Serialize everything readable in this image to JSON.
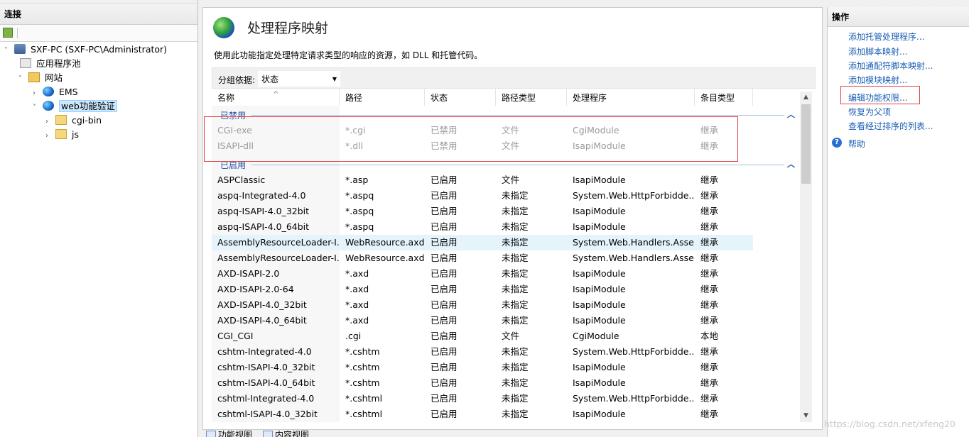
{
  "left_pane": {
    "title": "连接",
    "tree": [
      {
        "label": "SXF-PC (SXF-PC\\Administrator)",
        "icon": "server-icon",
        "expanded": "˅"
      },
      {
        "label": "应用程序池",
        "icon": "app-pool-icon"
      },
      {
        "label": "网站",
        "icon": "sites-icon",
        "expanded": "˅"
      },
      {
        "label": "EMS",
        "icon": "globe-icon",
        "expanded": "›"
      },
      {
        "label": "web功能验证",
        "icon": "globe-icon",
        "expanded": "˅",
        "selected": true
      },
      {
        "label": "cgi-bin",
        "icon": "folder-icon",
        "expanded": "›"
      },
      {
        "label": "js",
        "icon": "folder-icon",
        "expanded": "›"
      }
    ]
  },
  "center": {
    "title": "处理程序映射",
    "description": "使用此功能指定处理特定请求类型的响应的资源，如 DLL 和托管代码。",
    "group_by_label": "分组依据:",
    "group_by_value": "状态",
    "columns": [
      "名称",
      "路径",
      "状态",
      "路径类型",
      "处理程序",
      "条目类型"
    ],
    "groups": {
      "disabled": "已禁用",
      "enabled": "已启用"
    },
    "disabled_rows": [
      [
        "CGI-exe",
        "*.cgi",
        "已禁用",
        "文件",
        "CgiModule",
        "继承"
      ],
      [
        "ISAPI-dll",
        "*.dll",
        "已禁用",
        "文件",
        "IsapiModule",
        "继承"
      ]
    ],
    "enabled_rows": [
      [
        "ASPClassic",
        "*.asp",
        "已启用",
        "文件",
        "IsapiModule",
        "继承"
      ],
      [
        "aspq-Integrated-4.0",
        "*.aspq",
        "已启用",
        "未指定",
        "System.Web.HttpForbidde...",
        "继承"
      ],
      [
        "aspq-ISAPI-4.0_32bit",
        "*.aspq",
        "已启用",
        "未指定",
        "IsapiModule",
        "继承"
      ],
      [
        "aspq-ISAPI-4.0_64bit",
        "*.aspq",
        "已启用",
        "未指定",
        "IsapiModule",
        "继承"
      ],
      [
        "AssemblyResourceLoader-I...",
        "WebResource.axd",
        "已启用",
        "未指定",
        "System.Web.Handlers.Asse...",
        "继承"
      ],
      [
        "AssemblyResourceLoader-I...",
        "WebResource.axd",
        "已启用",
        "未指定",
        "System.Web.Handlers.Asse...",
        "继承"
      ],
      [
        "AXD-ISAPI-2.0",
        "*.axd",
        "已启用",
        "未指定",
        "IsapiModule",
        "继承"
      ],
      [
        "AXD-ISAPI-2.0-64",
        "*.axd",
        "已启用",
        "未指定",
        "IsapiModule",
        "继承"
      ],
      [
        "AXD-ISAPI-4.0_32bit",
        "*.axd",
        "已启用",
        "未指定",
        "IsapiModule",
        "继承"
      ],
      [
        "AXD-ISAPI-4.0_64bit",
        "*.axd",
        "已启用",
        "未指定",
        "IsapiModule",
        "继承"
      ],
      [
        "CGI_CGI",
        ".cgi",
        "已启用",
        "文件",
        "CgiModule",
        "本地"
      ],
      [
        "cshtm-Integrated-4.0",
        "*.cshtm",
        "已启用",
        "未指定",
        "System.Web.HttpForbidde...",
        "继承"
      ],
      [
        "cshtm-ISAPI-4.0_32bit",
        "*.cshtm",
        "已启用",
        "未指定",
        "IsapiModule",
        "继承"
      ],
      [
        "cshtm-ISAPI-4.0_64bit",
        "*.cshtm",
        "已启用",
        "未指定",
        "IsapiModule",
        "继承"
      ],
      [
        "cshtml-Integrated-4.0",
        "*.cshtml",
        "已启用",
        "未指定",
        "System.Web.HttpForbidde...",
        "继承"
      ],
      [
        "cshtml-ISAPI-4.0_32bit",
        "*.cshtml",
        "已启用",
        "未指定",
        "IsapiModule",
        "继承"
      ]
    ],
    "view_tabs": [
      "功能视图",
      "内容视图"
    ]
  },
  "right_pane": {
    "title": "操作",
    "actions": [
      "添加托管处理程序...",
      "添加脚本映射...",
      "添加通配符脚本映射...",
      "添加模块映射...",
      "编辑功能权限...",
      "恢复为父项",
      "查看经过排序的列表..."
    ],
    "help": "帮助"
  },
  "watermark": "https://blog.csdn.net/xfeng20",
  "colors": {
    "link": "#1a5fb4",
    "group_header": "#1f4fa8",
    "highlight_box": "#e0403f",
    "selected_row": "#e5f3fb"
  }
}
